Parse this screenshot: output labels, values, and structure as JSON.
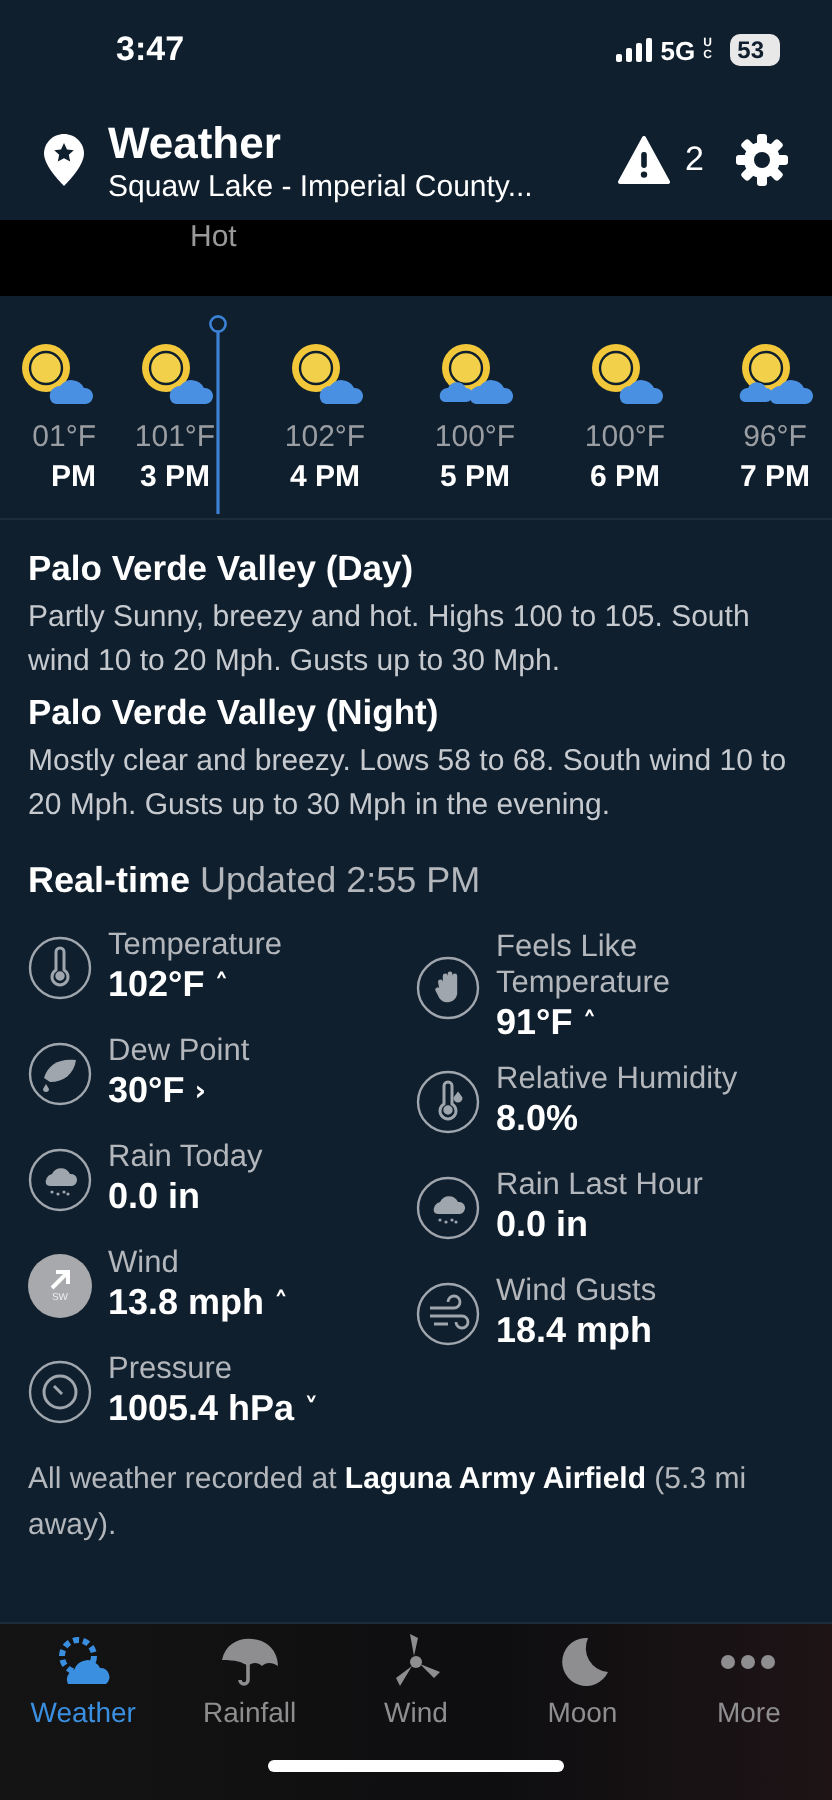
{
  "status_bar": {
    "time": "3:47",
    "network": "5G",
    "network_sub": "UC",
    "battery": "53"
  },
  "header": {
    "title": "Weather",
    "subtitle": "Squaw Lake - Imperial County...",
    "alert_count": "2"
  },
  "banner": {
    "text": "Hot"
  },
  "hourly": [
    {
      "kind": "sun_cloud",
      "temp": "01°F",
      "time": "PM"
    },
    {
      "kind": "sun_cloud",
      "temp": "101°F",
      "time": "3 PM"
    },
    {
      "kind": "sun_cloud",
      "temp": "102°F",
      "time": "4 PM"
    },
    {
      "kind": "sun_clouds",
      "temp": "100°F",
      "time": "5 PM"
    },
    {
      "kind": "sun_cloud",
      "temp": "100°F",
      "time": "6 PM"
    },
    {
      "kind": "sun_clouds",
      "temp": "96°F",
      "time": "7 PM"
    }
  ],
  "forecasts": [
    {
      "title": "Palo Verde Valley (Day)",
      "text": "Partly Sunny, breezy and hot. Highs 100 to 105. South wind 10 to 20 Mph. Gusts up to 30 Mph."
    },
    {
      "title": "Palo Verde Valley (Night)",
      "text": "Mostly clear and breezy. Lows 58 to 68. South wind 10 to 20 Mph. Gusts up to 30 Mph in the evening."
    }
  ],
  "realtime": {
    "title": "Real-time",
    "updated": "Updated 2:55 PM",
    "left": [
      {
        "kind": "thermometer",
        "label": "Temperature",
        "value": "102°F",
        "trend": "˄"
      },
      {
        "kind": "dew",
        "label": "Dew Point",
        "value": "30°F",
        "trend": "›"
      },
      {
        "kind": "rain",
        "label": "Rain Today",
        "value": "0.0 in"
      },
      {
        "kind": "wind",
        "label": "Wind",
        "value": "13.8 mph",
        "trend": "˄",
        "direction": "SW"
      },
      {
        "kind": "gauge",
        "label": "Pressure",
        "value": "1005.4 hPa",
        "trend": "˅"
      }
    ],
    "right": [
      {
        "kind": "hand",
        "label": "Feels Like Temperature",
        "value": "91°F",
        "trend": "˄"
      },
      {
        "kind": "humidity",
        "label": "Relative Humidity",
        "value": "8.0%"
      },
      {
        "kind": "rain",
        "label": "Rain Last Hour",
        "value": "0.0 in"
      },
      {
        "kind": "gusts",
        "label": "Wind Gusts",
        "value": "18.4 mph"
      }
    ],
    "footnote": "All weather recorded at **Laguna Army Airfield** (5.3 mi away)."
  },
  "tabs": [
    {
      "kind": "weather",
      "label": "Weather",
      "selected": true
    },
    {
      "kind": "umbrella",
      "label": "Rainfall",
      "selected": false
    },
    {
      "kind": "turbine",
      "label": "Wind",
      "selected": false
    },
    {
      "kind": "moon",
      "label": "Moon",
      "selected": false
    },
    {
      "kind": "more",
      "label": "More",
      "selected": false
    }
  ]
}
